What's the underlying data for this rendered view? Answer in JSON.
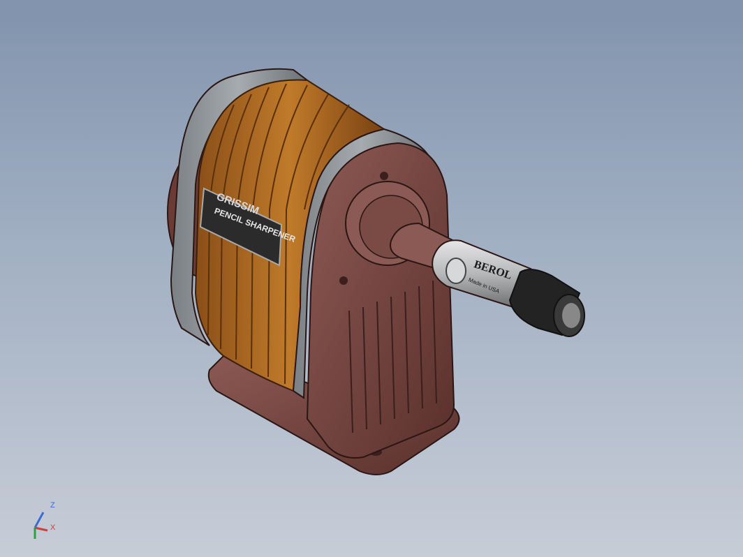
{
  "viewport": {
    "background_top": "#8193ad",
    "background_bottom": "#c7cdd7"
  },
  "model": {
    "name": "pencil sharpener",
    "label_brand": "GRISSIM",
    "label_product": "PENCIL SHARPENER",
    "handle_brand": "BEROL",
    "handle_subtext": "Made in USA",
    "colors": {
      "body": "#7d4a45",
      "band": "#8f9598",
      "coil": "#b06a22",
      "handle": "#c8c9cb",
      "grip": "#1d1d1d"
    }
  },
  "triad": {
    "z_label": "Z",
    "x_label": "X",
    "y_color": "#2ea043",
    "x_color": "#d43b3b",
    "z_color": "#3b6bd6"
  }
}
